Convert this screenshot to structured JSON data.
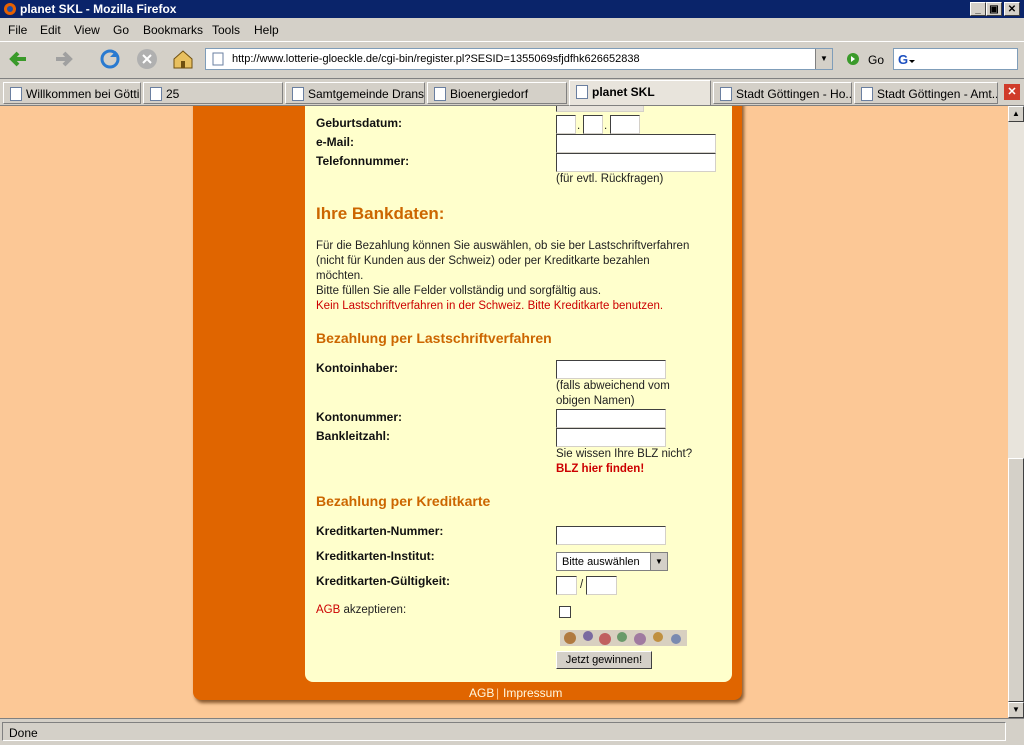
{
  "window": {
    "title": "planet SKL - Mozilla Firefox",
    "minimize": "_",
    "maximize": "▣",
    "close": "✕"
  },
  "menu": [
    "File",
    "Edit",
    "View",
    "Go",
    "Bookmarks",
    "Tools",
    "Help"
  ],
  "toolbar": {
    "url": "http://www.lotterie-gloeckle.de/cgi-bin/register.pl?SESID=1355069sfjdfhk626652838",
    "go_label": "Go",
    "search_value": ""
  },
  "tabs": [
    {
      "label": "Willkommen bei Götti..."
    },
    {
      "label": "25"
    },
    {
      "label": "Samtgemeinde Drans..."
    },
    {
      "label": "Bioenergiedorf"
    },
    {
      "label": "planet SKL",
      "active": true
    },
    {
      "label": "Stadt Göttingen - Ho..."
    },
    {
      "label": "Stadt Göttingen - Amt..."
    }
  ],
  "form": {
    "personal": {
      "geburtsdatum_label": "Geburtsdatum:",
      "dot1": ".",
      "dot2": ".",
      "email_label": "e-Mail:",
      "telefon_label": "Telefonnummer:",
      "telefon_hint": "(für evtl. Rückfragen)"
    },
    "bank_heading": "Ihre Bankdaten:",
    "bank_intro_1": "Für die Bezahlung können Sie auswählen, ob sie ber Lastschriftverfahren",
    "bank_intro_2": "(nicht für Kunden aus der Schweiz) oder per Kreditkarte bezahlen",
    "bank_intro_3": "möchten.",
    "bank_intro_4": "Bitte füllen Sie alle Felder vollständig und sorgfältig aus.",
    "bank_warning": "Kein Lastschriftverfahren in der Schweiz. Bitte Kreditkarte benutzen.",
    "lastschrift_heading": "Bezahlung per Lastschriftverfahren",
    "kontoinhaber_label": "Kontoinhaber:",
    "kontoinhaber_hint_1": "(falls abweichend vom",
    "kontoinhaber_hint_2": "obigen Namen)",
    "kontonummer_label": "Kontonummer:",
    "blz_label": "Bankleitzahl:",
    "blz_hint": "Sie wissen Ihre BLZ nicht?",
    "blz_link": "BLZ hier finden!",
    "kredit_heading": "Bezahlung per Kreditkarte",
    "kk_nummer_label": "Kreditkarten-Nummer:",
    "kk_institut_label": "Kreditkarten-Institut:",
    "kk_institut_value": "Bitte auswählen",
    "kk_gueltig_label": "Kreditkarten-Gültigkeit:",
    "kk_slash": "/",
    "agb_link": "AGB",
    "agb_text": "akzeptieren:",
    "submit_label": "Jetzt gewinnen!"
  },
  "footer": {
    "agb": "AGB",
    "sep": "|",
    "impressum": "Impressum"
  },
  "status": {
    "text": "Done"
  },
  "colors": {
    "accent": "#e06500",
    "panel": "#ffffcc",
    "page": "#fcc896",
    "heading": "#cc6600"
  }
}
